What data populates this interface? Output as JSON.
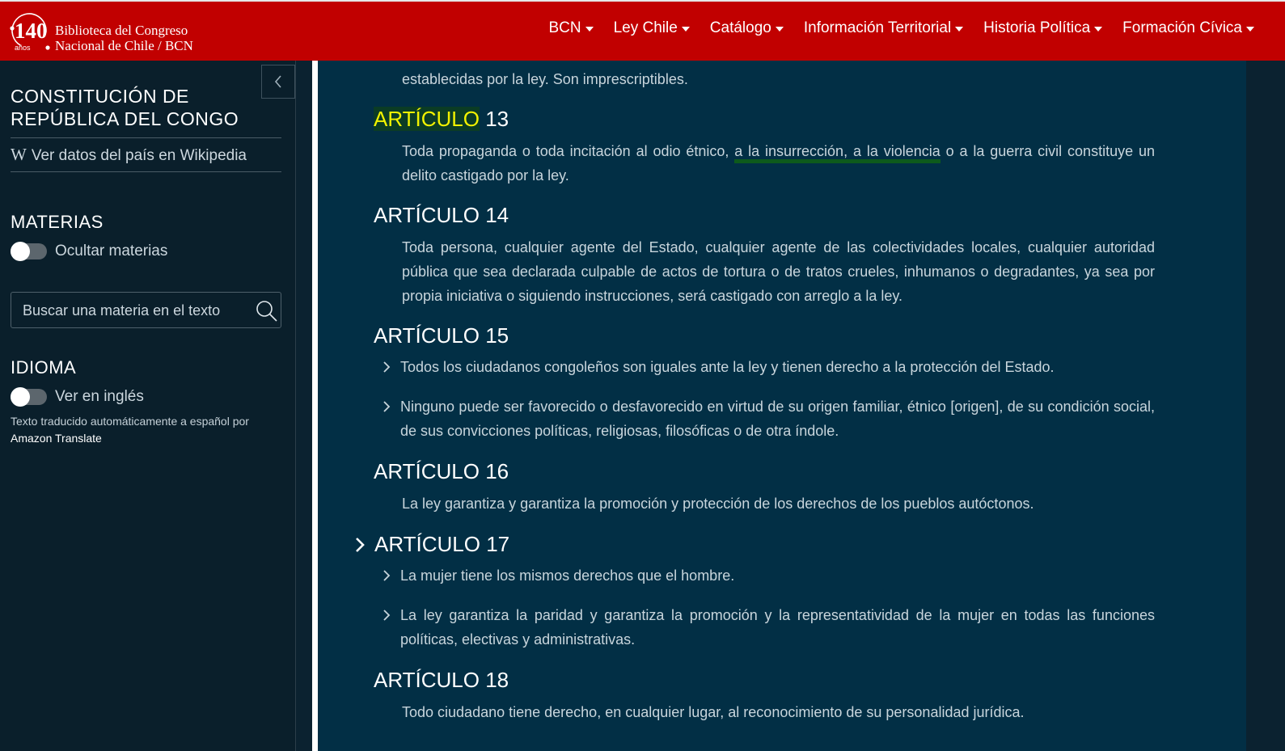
{
  "header": {
    "logo": {
      "anniversary": "140",
      "anniversary_sub": "años",
      "line1": "Biblioteca del Congreso",
      "line2": "Nacional de Chile / BCN"
    },
    "nav": [
      "BCN",
      "Ley Chile",
      "Catálogo",
      "Información Territorial",
      "Historia Política",
      "Formación Cívica"
    ]
  },
  "sidebar": {
    "country_title": "CONSTITUCIÓN DE REPÚBLICA DEL CONGO",
    "wiki_link": "Ver datos del país en Wikipedia",
    "materias_heading": "MATERIAS",
    "hide_materias_label": "Ocultar materias",
    "hide_materias_on": false,
    "search_placeholder": "Buscar una materia en el texto",
    "idioma_heading": "IDIOMA",
    "english_label": "Ver en inglés",
    "english_on": false,
    "translated_note": "Texto traducido automáticamente a español por",
    "translator": "Amazon Translate"
  },
  "content": {
    "top_fragment": "establecidas por la ley. Son imprescriptibles.",
    "articles": [
      {
        "heading_hl": "ARTÍCULO",
        "heading_num": " 13",
        "text_before": "Toda propaganda o toda incitación al odio étnico, ",
        "text_marked": "a la insurrección, a la violencia",
        "text_after": " o a la guerra civil constituye un delito castigado por la ley."
      },
      {
        "heading": "ARTÍCULO 14",
        "text": "Toda persona, cualquier agente del Estado, cualquier agente de las colectividades locales, cualquier autoridad pública que sea declarada culpable de actos de tortura o de tratos crueles, inhumanos o degradantes, ya sea por propia iniciativa o siguiendo instrucciones, será castigado con arreglo a la ley."
      },
      {
        "heading": "ARTÍCULO 15",
        "items": [
          "Todos los ciudadanos congoleños son iguales ante la ley y tienen derecho a la protección del Estado.",
          "Ninguno puede ser favorecido o desfavorecido en virtud de su origen familiar, étnico [origen], de su condición social, de sus convicciones políticas, religiosas, filosóficas o de otra índole."
        ]
      },
      {
        "heading": "ARTÍCULO 16",
        "text": "La ley garantiza y garantiza la promoción y protección de los derechos de los pueblos autóctonos."
      },
      {
        "heading": "ARTÍCULO 17",
        "items": [
          "La mujer tiene los mismos derechos que el hombre.",
          "La ley garantiza la paridad y garantiza la promoción y la representatividad de la mujer en todas las funciones políticas, electivas y administrativas."
        ]
      },
      {
        "heading": "ARTÍCULO 18",
        "text": "Todo ciudadano tiene derecho, en cualquier lugar, al reconocimiento de su personalidad jurídica."
      }
    ]
  },
  "colors": {
    "header_red": "#c10000",
    "sidebar_bg": "#0a1f2b",
    "content_bg": "#022f45",
    "search_highlight": "#f2f200",
    "marked_underline": "#0d5a1c"
  },
  "icons": [
    "collapse-sidebar-icon",
    "wikipedia-icon",
    "search-icon",
    "chevron-right-icon",
    "caret-down-icon"
  ]
}
